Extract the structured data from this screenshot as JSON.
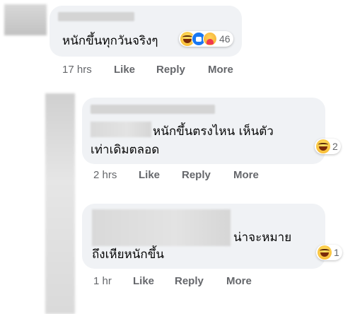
{
  "comments": [
    {
      "text_lines": [
        "หนักขึ้นทุกวันจริงๆ"
      ],
      "reaction_count": "46",
      "reaction_icons": [
        "haha-icon",
        "like-icon",
        "care-icon"
      ],
      "time": "17 hrs",
      "actions": [
        "Like",
        "Reply",
        "More"
      ]
    },
    {
      "text_lines": [
        "หนักขึ้นตรงไหน เห็นตัว",
        "เท่าเดิมตลอด"
      ],
      "reaction_count": "2",
      "reaction_icons": [
        "haha-icon"
      ],
      "time": "2 hrs",
      "actions": [
        "Like",
        "Reply",
        "More"
      ]
    },
    {
      "text_lines": [
        "น่าจะหมาย",
        "ถึงเหียหนักขึ้น"
      ],
      "reaction_count": "1",
      "reaction_icons": [
        "haha-icon"
      ],
      "time": "1 hr",
      "actions": [
        "Like",
        "Reply",
        "More"
      ]
    }
  ],
  "colors": {
    "bubble": "#f0f2f5",
    "meta_text": "#65676b",
    "like_blue": "#1877f2",
    "haha_yellow": "#f7b125"
  }
}
